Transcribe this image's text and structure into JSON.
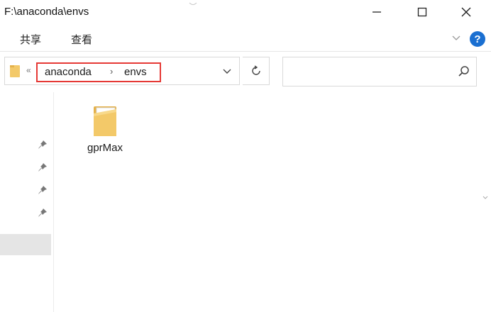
{
  "window": {
    "title": "F:\\anaconda\\envs",
    "minimize_icon": "minimize-icon",
    "maximize_icon": "maximize-icon",
    "close_icon": "close-icon"
  },
  "ribbon": {
    "tabs": [
      {
        "label": "共享"
      },
      {
        "label": "查看"
      }
    ],
    "expand_icon": "chevron-down-icon",
    "help_label": "?"
  },
  "address": {
    "overflow": "«",
    "breadcrumbs": [
      {
        "label": "anaconda"
      },
      {
        "label": "envs"
      }
    ],
    "separator": "›",
    "highlight_color": "#e53935"
  },
  "search": {
    "placeholder": "",
    "value": ""
  },
  "navigation": {
    "pinned_items": 4,
    "partial_text": ")"
  },
  "content": {
    "items": [
      {
        "name": "gprMax",
        "type": "folder"
      }
    ]
  },
  "colors": {
    "folder": "#f3c969",
    "help": "#1a6fd1",
    "selection": "#e5e5e5"
  }
}
